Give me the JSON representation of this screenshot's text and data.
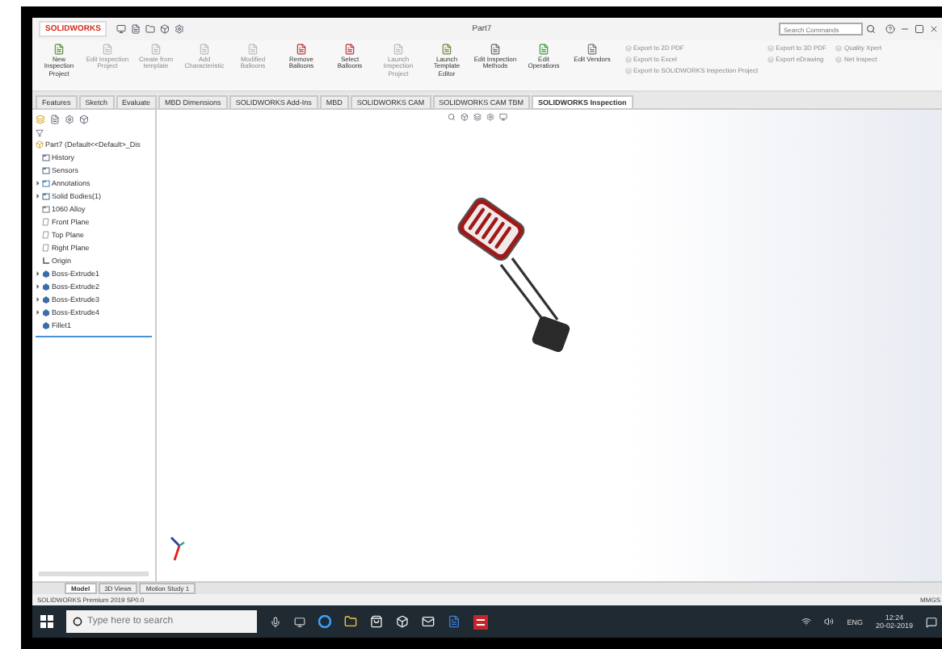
{
  "title_bar": {
    "logo": "SOLIDWORKS",
    "document": "Part7",
    "search": {
      "placeholder": "Search Commands"
    }
  },
  "ribbon": {
    "buttons": [
      {
        "label": "New Inspection Project",
        "disabled": false
      },
      {
        "label": "Edit Inspection Project",
        "disabled": true
      },
      {
        "label": "Create from template",
        "disabled": true
      },
      {
        "label": "Add Characteristic",
        "disabled": true
      },
      {
        "label": "Modified Balloons",
        "disabled": true
      },
      {
        "label": "Remove Balloons",
        "disabled": false
      },
      {
        "label": "Select Balloons",
        "disabled": false
      },
      {
        "label": "Launch Inspection Project",
        "disabled": true
      },
      {
        "label": "Launch Template Editor",
        "disabled": false
      },
      {
        "label": "Edit Inspection Methods",
        "disabled": false
      },
      {
        "label": "Edit Operations",
        "disabled": false
      },
      {
        "label": "Edit Vendors",
        "disabled": false
      }
    ],
    "export_items": [
      {
        "label": "Export to 2D PDF",
        "disabled": true
      },
      {
        "label": "Export to 3D PDF",
        "disabled": true
      },
      {
        "label": "Quality Xpert",
        "disabled": true
      },
      {
        "label": "Export to Excel",
        "disabled": true
      },
      {
        "label": "Export eDrawing",
        "disabled": true
      },
      {
        "label": "Net Inspect",
        "disabled": true
      },
      {
        "label": "Export to SOLIDWORKS Inspection Project",
        "disabled": true
      }
    ]
  },
  "tabs": [
    {
      "label": "Features",
      "selected": false
    },
    {
      "label": "Sketch",
      "selected": false
    },
    {
      "label": "Evaluate",
      "selected": false
    },
    {
      "label": "MBD Dimensions",
      "selected": false
    },
    {
      "label": "SOLIDWORKS Add-Ins",
      "selected": false
    },
    {
      "label": "MBD",
      "selected": false
    },
    {
      "label": "SOLIDWORKS CAM",
      "selected": false
    },
    {
      "label": "SOLIDWORKS CAM TBM",
      "selected": false
    },
    {
      "label": "SOLIDWORKS Inspection",
      "selected": true
    }
  ],
  "feature_tree": {
    "root": "Part7  (Default<<Default>_Dis",
    "items": [
      {
        "label": "History",
        "kind": "history",
        "collapsed": false
      },
      {
        "label": "Sensors",
        "kind": "sensor",
        "collapsed": false
      },
      {
        "label": "Annotations",
        "kind": "annotation",
        "collapsed": true
      },
      {
        "label": "Solid Bodies(1)",
        "kind": "body",
        "collapsed": true
      },
      {
        "label": "1060 Alloy",
        "kind": "material",
        "collapsed": false
      },
      {
        "label": "Front Plane",
        "kind": "plane",
        "collapsed": false
      },
      {
        "label": "Top Plane",
        "kind": "plane",
        "collapsed": false
      },
      {
        "label": "Right Plane",
        "kind": "plane",
        "collapsed": false
      },
      {
        "label": "Origin",
        "kind": "origin",
        "collapsed": false
      },
      {
        "label": "Boss-Extrude1",
        "kind": "feature",
        "collapsed": true
      },
      {
        "label": "Boss-Extrude2",
        "kind": "feature",
        "collapsed": true
      },
      {
        "label": "Boss-Extrude3",
        "kind": "feature",
        "collapsed": true
      },
      {
        "label": "Boss-Extrude4",
        "kind": "feature",
        "collapsed": true
      },
      {
        "label": "Fillet1",
        "kind": "fillet",
        "collapsed": false
      }
    ]
  },
  "bottom_tabs": [
    {
      "label": "Model",
      "selected": true
    },
    {
      "label": "3D Views",
      "selected": false
    },
    {
      "label": "Motion Study 1",
      "selected": false
    }
  ],
  "status_bar": {
    "product": "SOLIDWORKS Premium 2019 SP0.0",
    "units": "MMGS"
  },
  "taskbar": {
    "search": {
      "placeholder": "Type here to search"
    },
    "language": "ENG",
    "time": "12:24",
    "date": "20-02-2019"
  }
}
